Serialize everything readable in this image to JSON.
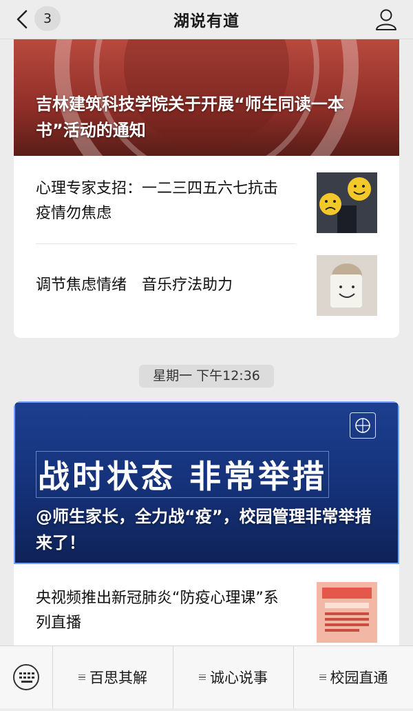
{
  "header": {
    "title": "湖说有道",
    "unread_count": "3"
  },
  "card1": {
    "hero_caption": "吉林建筑科技学院关于开展“师生同读一本书”活动的通知",
    "items": [
      {
        "title": "心理专家支招：一二三四五六七抗击疫情勿焦虑",
        "thumb_icon": "smiley-faces-thumbnail"
      },
      {
        "title": "调节焦虑情绪　音乐疗法助力",
        "thumb_icon": "smiling-mask-thumbnail"
      }
    ]
  },
  "timestamp": "星期一 下午12:36",
  "card2": {
    "hero_big": "战时状态 非常举措",
    "hero_caption": "@师生家长，全力战“疫”，校园管理非常举措来了！",
    "items": [
      {
        "title": "央视频推出新冠肺炎“防疫心理课”系列直播",
        "thumb_icon": "poster-thumbnail"
      }
    ]
  },
  "bottom_menu": [
    {
      "label": "百思其解"
    },
    {
      "label": "诚心说事"
    },
    {
      "label": "校园直通"
    }
  ],
  "colors": {
    "accent_blue": "#15327a",
    "accent_red": "#8e2e27"
  }
}
